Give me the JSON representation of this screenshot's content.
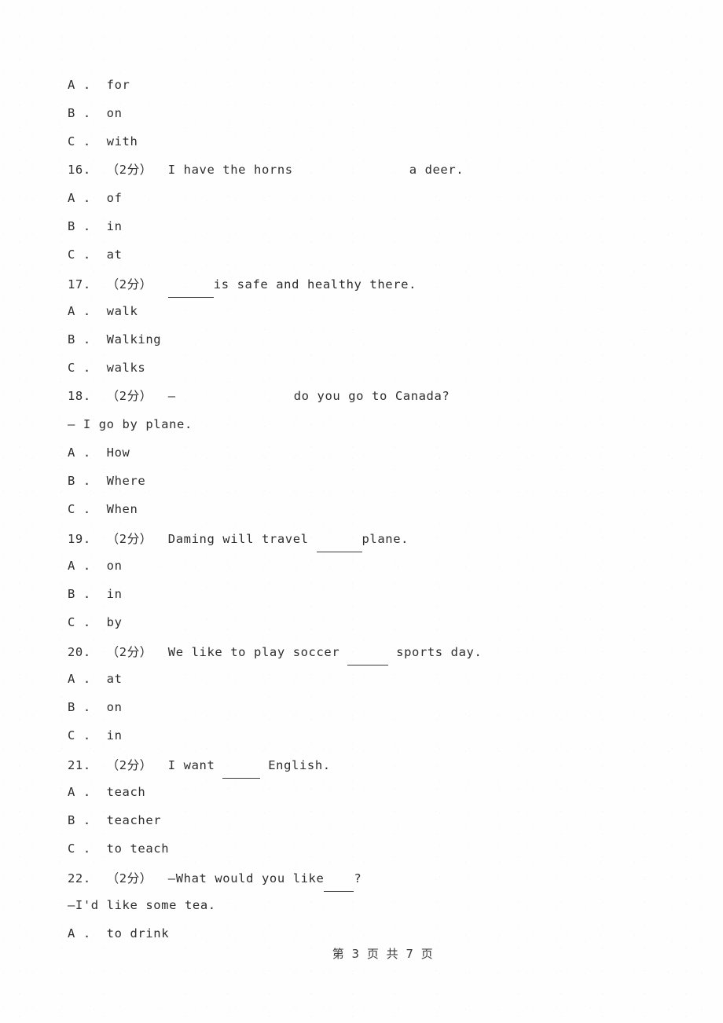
{
  "document": {
    "page_footer": "第 3 页 共 7 页",
    "page_number": 3,
    "total_pages": 7,
    "text_color": "#2e2e2e",
    "background_color": "#ffffff"
  },
  "leading_options": [
    {
      "label": "A .",
      "text": "for"
    },
    {
      "label": "B .",
      "text": "on"
    },
    {
      "label": "C .",
      "text": "with"
    }
  ],
  "questions": [
    {
      "number": "16.",
      "score": "（2分）",
      "stem_before": "I have the horns",
      "blank_kind": "gap",
      "stem_after": "a deer.",
      "continuation": null,
      "options": [
        {
          "label": "A .",
          "text": "of"
        },
        {
          "label": "B .",
          "text": "in"
        },
        {
          "label": "C .",
          "text": "at"
        }
      ]
    },
    {
      "number": "17.",
      "score": "（2分）",
      "stem_before": "",
      "blank_kind": "underline",
      "stem_after": "is safe and healthy there.",
      "continuation": null,
      "options": [
        {
          "label": "A .",
          "text": "walk"
        },
        {
          "label": "B .",
          "text": "Walking"
        },
        {
          "label": "C .",
          "text": "walks"
        }
      ]
    },
    {
      "number": "18.",
      "score": "（2分）",
      "stem_before": "—",
      "blank_kind": "gap",
      "stem_after": "do you go to Canada?",
      "continuation": "— I go by plane.",
      "options": [
        {
          "label": "A .",
          "text": "How"
        },
        {
          "label": "B .",
          "text": "Where"
        },
        {
          "label": "C .",
          "text": "When"
        }
      ]
    },
    {
      "number": "19.",
      "score": "（2分）",
      "stem_before": "Daming will travel ",
      "blank_kind": "underline",
      "stem_after": "plane.",
      "continuation": null,
      "options": [
        {
          "label": "A .",
          "text": "on"
        },
        {
          "label": "B .",
          "text": "in"
        },
        {
          "label": "C .",
          "text": "by"
        }
      ]
    },
    {
      "number": "20.",
      "score": "（2分）",
      "stem_before": "We like to play soccer ",
      "blank_kind": "underline",
      "stem_after": " sports day.",
      "continuation": null,
      "options": [
        {
          "label": "A .",
          "text": "at"
        },
        {
          "label": "B .",
          "text": "on"
        },
        {
          "label": "C .",
          "text": "in"
        }
      ]
    },
    {
      "number": "21.",
      "score": "（2分）",
      "stem_before": "I want ",
      "blank_kind": "underline",
      "stem_after": " English.",
      "continuation": null,
      "options": [
        {
          "label": "A .",
          "text": "teach"
        },
        {
          "label": "B .",
          "text": "teacher"
        },
        {
          "label": "C .",
          "text": "to teach"
        }
      ]
    },
    {
      "number": "22.",
      "score": "（2分）",
      "stem_before": "—What would you like",
      "blank_kind": "underline",
      "stem_after": "?",
      "continuation": "—I'd like some tea.",
      "options": [
        {
          "label": "A .",
          "text": "to drink"
        }
      ]
    }
  ]
}
